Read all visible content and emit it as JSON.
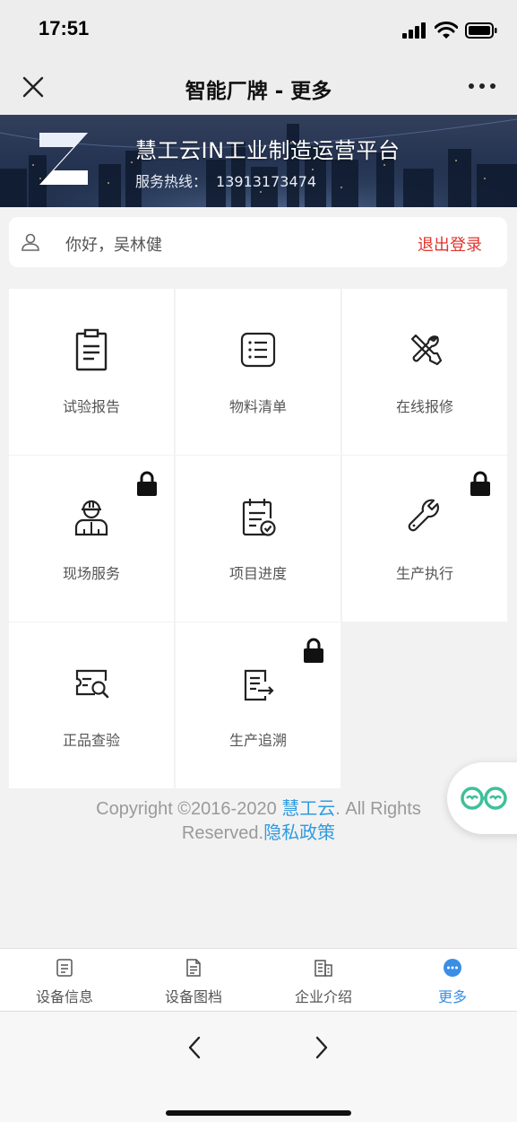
{
  "status": {
    "time": "17:51"
  },
  "nav": {
    "title": "智能厂牌 - 更多"
  },
  "banner": {
    "title": "慧工云IN工业制造运营平台",
    "hotline_label": "服务热线：",
    "hotline_number": "13913173474"
  },
  "user": {
    "greeting": "你好，吴林健",
    "logout_label": "退出登录"
  },
  "features": [
    {
      "label": "试验报告",
      "icon": "clipboard-icon",
      "locked": false
    },
    {
      "label": "物料清单",
      "icon": "list-icon",
      "locked": false
    },
    {
      "label": "在线报修",
      "icon": "tools-icon",
      "locked": false
    },
    {
      "label": "现场服务",
      "icon": "worker-icon",
      "locked": true
    },
    {
      "label": "项目进度",
      "icon": "calendar-check-icon",
      "locked": false
    },
    {
      "label": "生产执行",
      "icon": "wrench-icon",
      "locked": true
    },
    {
      "label": "正品查验",
      "icon": "ticket-search-icon",
      "locked": false
    },
    {
      "label": "生产追溯",
      "icon": "document-export-icon",
      "locked": true
    }
  ],
  "footer": {
    "copyright_prefix": "Copyright ©2016-2020 ",
    "brand": "慧工云",
    "copyright_suffix": ". All Rights Reserved.",
    "privacy": "隐私政策"
  },
  "tabs": [
    {
      "label": "设备信息",
      "icon": "document-icon",
      "active": false
    },
    {
      "label": "设备图档",
      "icon": "file-icon",
      "active": false
    },
    {
      "label": "企业介绍",
      "icon": "building-icon",
      "active": false
    },
    {
      "label": "更多",
      "icon": "more-dots-icon",
      "active": true
    }
  ],
  "colors": {
    "accent": "#3a8ee6",
    "logout": "#e2342d",
    "link": "#2f9be0"
  }
}
